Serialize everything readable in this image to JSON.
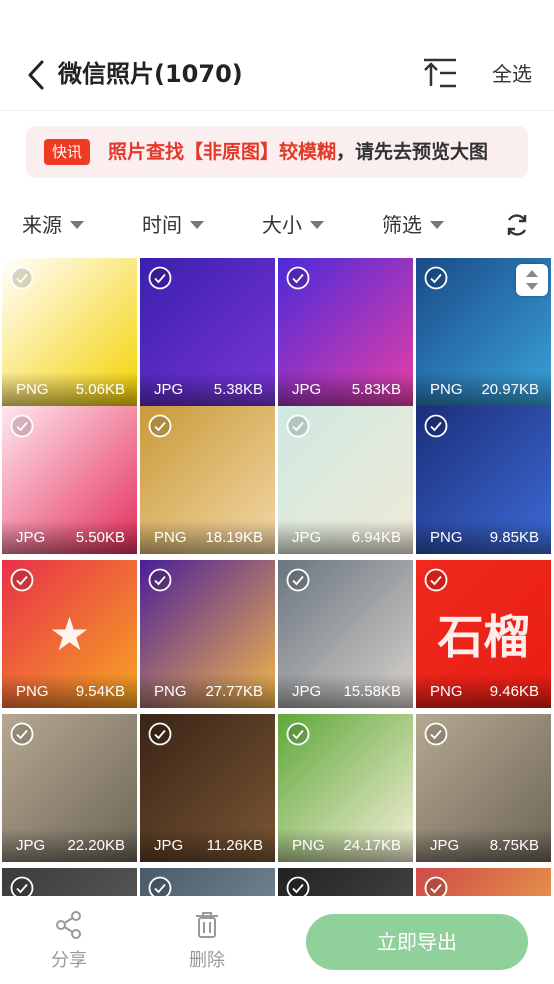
{
  "header": {
    "title": "微信照片(1070)",
    "select_all": "全选"
  },
  "notice": {
    "tag": "快讯",
    "text_red": "照片查找【非原图】较模糊",
    "text_dark": "，请先去预览大图"
  },
  "filters": [
    {
      "label": "来源"
    },
    {
      "label": "时间"
    },
    {
      "label": "大小"
    },
    {
      "label": "筛选"
    }
  ],
  "photos": [
    {
      "type": "PNG",
      "size": "5.06KB",
      "colors": [
        "#ffffff",
        "#f5d100"
      ],
      "glyph": ""
    },
    {
      "type": "JPG",
      "size": "5.38KB",
      "colors": [
        "#3a1fae",
        "#7a36d6"
      ],
      "glyph": ""
    },
    {
      "type": "JPG",
      "size": "5.83KB",
      "colors": [
        "#4b2ad9",
        "#e63fa6"
      ],
      "glyph": ""
    },
    {
      "type": "PNG",
      "size": "20.97KB",
      "colors": [
        "#1a4a8a",
        "#3aa3d8"
      ],
      "glyph": ""
    },
    {
      "type": "JPG",
      "size": "5.50KB",
      "colors": [
        "#ffe7ef",
        "#e32d5a"
      ],
      "glyph": ""
    },
    {
      "type": "PNG",
      "size": "18.19KB",
      "colors": [
        "#c99a3a",
        "#f3d7a6"
      ],
      "glyph": ""
    },
    {
      "type": "JPG",
      "size": "6.94KB",
      "colors": [
        "#cfe9e2",
        "#f0ead6"
      ],
      "glyph": ""
    },
    {
      "type": "PNG",
      "size": "9.85KB",
      "colors": [
        "#1b2e7a",
        "#3d6bd6"
      ],
      "glyph": ""
    },
    {
      "type": "PNG",
      "size": "9.54KB",
      "colors": [
        "#e8304a",
        "#f6a623"
      ],
      "glyph": "★"
    },
    {
      "type": "PNG",
      "size": "27.77KB",
      "colors": [
        "#4a1e9a",
        "#f3b84a"
      ],
      "glyph": ""
    },
    {
      "type": "JPG",
      "size": "15.58KB",
      "colors": [
        "#6a7580",
        "#d8d2cc"
      ],
      "glyph": ""
    },
    {
      "type": "PNG",
      "size": "9.46KB",
      "colors": [
        "#f0281e",
        "#e81e14"
      ],
      "glyph": "石榴"
    },
    {
      "type": "JPG",
      "size": "22.20KB",
      "colors": [
        "#b6a891",
        "#6d6558"
      ],
      "glyph": ""
    },
    {
      "type": "JPG",
      "size": "11.26KB",
      "colors": [
        "#3a2416",
        "#7a5634"
      ],
      "glyph": ""
    },
    {
      "type": "PNG",
      "size": "24.17KB",
      "colors": [
        "#5fa83a",
        "#f6f0d8"
      ],
      "glyph": ""
    },
    {
      "type": "JPG",
      "size": "8.75KB",
      "colors": [
        "#b6a891",
        "#6d6558"
      ],
      "glyph": ""
    },
    {
      "type": "",
      "size": "",
      "colors": [
        "#3b3b3b",
        "#666666"
      ],
      "glyph": ""
    },
    {
      "type": "",
      "size": "",
      "colors": [
        "#4a5a6a",
        "#8a9aa6"
      ],
      "glyph": ""
    },
    {
      "type": "",
      "size": "",
      "colors": [
        "#222222",
        "#555555"
      ],
      "glyph": ""
    },
    {
      "type": "",
      "size": "",
      "colors": [
        "#d04a4a",
        "#f3c24a"
      ],
      "glyph": ""
    }
  ],
  "bottom_bar": {
    "share_label": "分享",
    "delete_label": "删除",
    "export_label": "立即导出"
  },
  "colors": {
    "accent_red": "#e23a2a",
    "export_button": "#8fd09b"
  }
}
